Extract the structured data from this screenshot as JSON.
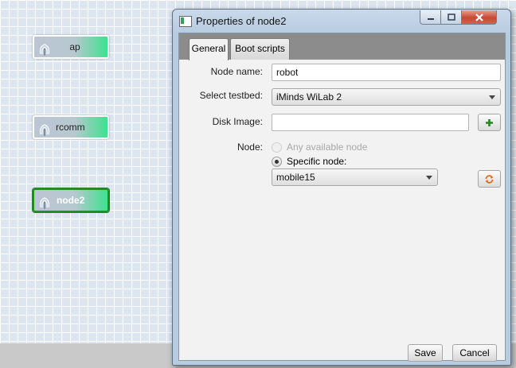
{
  "canvas": {
    "nodes": [
      {
        "label": "ap",
        "selected": false
      },
      {
        "label": "rcomm",
        "selected": false
      },
      {
        "label": "node2",
        "selected": true
      }
    ],
    "node_icon": "wireless-signal-icon",
    "colors": {
      "node_gradient_end": "#3fe08f",
      "selected_border": "#1f8f1f"
    }
  },
  "dialog": {
    "title": "Properties of node2",
    "title_icon": "window-app-icon",
    "window_buttons": [
      "minimize-icon",
      "maximize-icon",
      "close-icon"
    ],
    "tabs": [
      {
        "label": "General",
        "active": true
      },
      {
        "label": "Boot scripts",
        "active": false
      }
    ],
    "general": {
      "node_name_label": "Node name:",
      "node_name_value": "robot",
      "testbed_label": "Select testbed:",
      "testbed_value": "iMinds WiLab 2",
      "disk_image_label": "Disk Image:",
      "disk_image_value": "",
      "add_icon": "plus-icon",
      "node_label": "Node:",
      "option_any": "Any available node",
      "option_any_enabled": false,
      "option_specific": "Specific node:",
      "selected_option": "Specific node:",
      "specific_node_value": "mobile15",
      "refresh_icon": "refresh-icon"
    },
    "buttons": {
      "save": "Save",
      "cancel": "Cancel"
    }
  }
}
